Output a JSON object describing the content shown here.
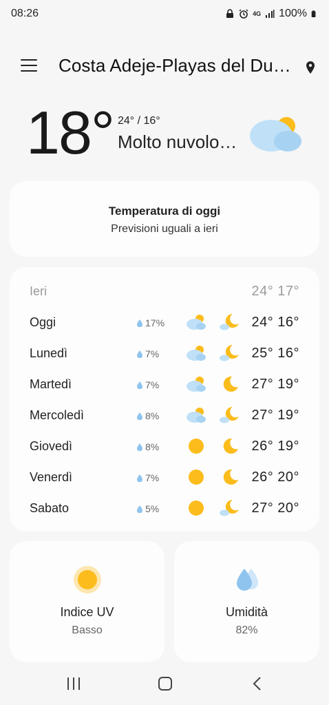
{
  "status": {
    "time": "08:26",
    "battery": "100%",
    "network": "4G"
  },
  "header": {
    "location": "Costa Adeje-Playas del Du…"
  },
  "current": {
    "temp": "18°",
    "hilo": "24° / 16°",
    "condition": "Molto nuvolo…"
  },
  "today_card": {
    "title": "Temperatura di oggi",
    "subtitle": "Previsioni uguali a ieri"
  },
  "forecast": {
    "yesterday": {
      "label": "Ieri",
      "temps": "24° 17°"
    },
    "days": [
      {
        "day": "Oggi",
        "precip": "17%",
        "day_icon": "partly-cloudy-icon",
        "night_icon": "partly-cloudy-night-icon",
        "temps": "24° 16°"
      },
      {
        "day": "Lunedì",
        "precip": "7%",
        "day_icon": "partly-cloudy-icon",
        "night_icon": "partly-cloudy-night-icon",
        "temps": "25° 16°"
      },
      {
        "day": "Martedì",
        "precip": "7%",
        "day_icon": "partly-cloudy-icon",
        "night_icon": "moon-icon",
        "temps": "27° 19°"
      },
      {
        "day": "Mercoledì",
        "precip": "8%",
        "day_icon": "partly-cloudy-icon",
        "night_icon": "partly-cloudy-night-icon",
        "temps": "27° 19°"
      },
      {
        "day": "Giovedì",
        "precip": "8%",
        "day_icon": "sun-icon",
        "night_icon": "moon-icon",
        "temps": "26° 19°"
      },
      {
        "day": "Venerdì",
        "precip": "7%",
        "day_icon": "sun-icon",
        "night_icon": "moon-icon",
        "temps": "26° 20°"
      },
      {
        "day": "Sabato",
        "precip": "5%",
        "day_icon": "sun-icon",
        "night_icon": "partly-cloudy-night-icon",
        "temps": "27° 20°"
      }
    ]
  },
  "uv": {
    "title": "Indice UV",
    "value": "Basso"
  },
  "humidity": {
    "title": "Umidità",
    "value": "82%"
  },
  "colors": {
    "sun": "#fbbc1c",
    "cloud": "#bfe0f7",
    "cloud_dark": "#a7d2f2",
    "drop": "#8ec4ee"
  }
}
